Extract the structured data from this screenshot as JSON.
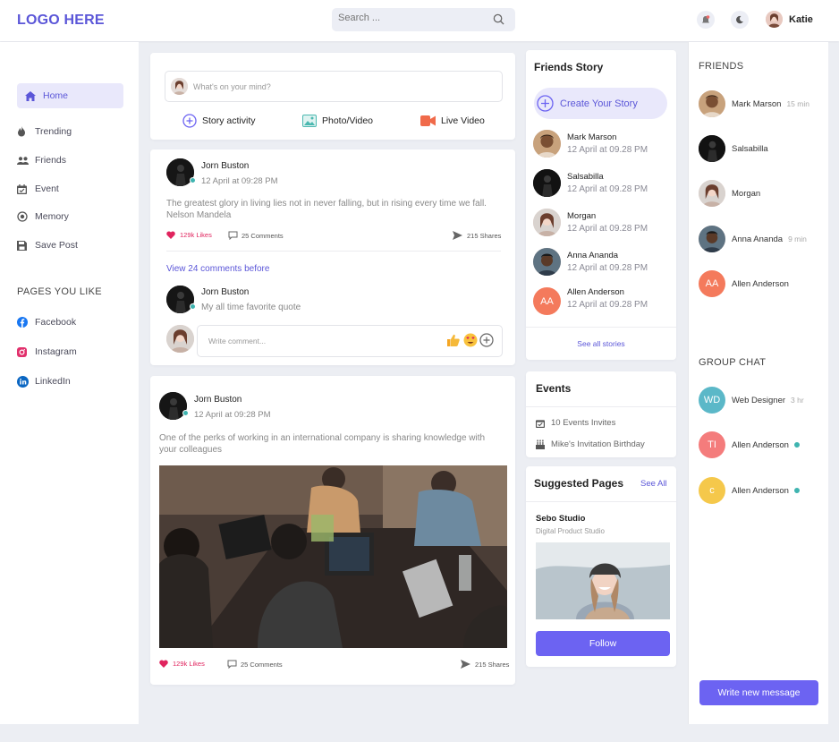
{
  "header": {
    "logo": "LOGO HERE",
    "search_placeholder": "Search ...",
    "user_name": "Katie"
  },
  "sidebar": {
    "items": [
      {
        "label": "Home",
        "icon": "home-icon"
      },
      {
        "label": "Trending",
        "icon": "flame-icon"
      },
      {
        "label": "Friends",
        "icon": "friends-icon"
      },
      {
        "label": "Event",
        "icon": "calendar-icon"
      },
      {
        "label": "Memory",
        "icon": "memory-icon"
      },
      {
        "label": "Save Post",
        "icon": "save-icon"
      }
    ],
    "pages_title": "PAGES YOU LIKE",
    "pages": [
      {
        "label": "Facebook",
        "color": "#1877f2"
      },
      {
        "label": "Instagram",
        "color": "#e1306c"
      },
      {
        "label": "LinkedIn",
        "color": "#0a66c2"
      }
    ]
  },
  "composer": {
    "placeholder": "What's on your mind?",
    "actions": [
      {
        "label": "Story activity"
      },
      {
        "label": "Photo/Video"
      },
      {
        "label": "Live Video"
      }
    ]
  },
  "post1": {
    "author": "Jorn Buston",
    "time": "12 April at 09:28 PM",
    "text": "The greatest glory in living lies not in never falling, but in rising every time we fall. Nelson Mandela",
    "likes": "129k Likes",
    "comments": "25 Comments",
    "shares": "215 Shares",
    "view_comments": "View 24  comments before",
    "comment": {
      "author": "Jorn Buston",
      "text": "My all time favorite quote"
    },
    "write_placeholder": "Write comment..."
  },
  "post2": {
    "author": "Jorn Buston",
    "time": "12 April at 09:28 PM",
    "text": "One of the perks of working in an international company is sharing knowledge with your colleagues",
    "likes": "129k Likes",
    "comments": "25 Comments",
    "shares": "215 Shares"
  },
  "stories": {
    "title": "Friends Story",
    "create": "Create Your Story",
    "items": [
      {
        "name": "Mark Marson",
        "time": "12 April at 09.28 PM"
      },
      {
        "name": "Salsabilla",
        "time": "12 April at 09.28 PM"
      },
      {
        "name": "Morgan",
        "time": "12 April at 09.28 PM"
      },
      {
        "name": "Anna Ananda",
        "time": "12 April at 09.28 PM"
      },
      {
        "name": "Allen Anderson",
        "time": "12 April at 09.28 PM",
        "initials": "AA"
      }
    ],
    "see_all": "See all stories"
  },
  "events": {
    "title": "Events",
    "items": [
      {
        "label": "10 Events Invites"
      },
      {
        "label": "Mike's Invitation Birthday"
      }
    ]
  },
  "suggested": {
    "title": "Suggested Pages",
    "see_all": "See All",
    "page_name": "Sebo Studio",
    "page_sub": "Digital Product Studio",
    "follow": "Follow"
  },
  "friends": {
    "title": "FRIENDS",
    "items": [
      {
        "name": "Mark Marson",
        "status": "15 min"
      },
      {
        "name": "Salsabilla",
        "status": ""
      },
      {
        "name": "Morgan",
        "status": ""
      },
      {
        "name": "Anna Ananda",
        "status": "9 min"
      },
      {
        "name": "Allen Anderson",
        "status": "",
        "initials": "AA"
      }
    ]
  },
  "group_chat": {
    "title": "GROUP CHAT",
    "items": [
      {
        "name": "Web Designer",
        "status": "3 hr",
        "initials": "WD",
        "color": "#5bb8c8"
      },
      {
        "name": "Allen Anderson",
        "status": "",
        "initials": "TI",
        "color": "#f47c7c"
      },
      {
        "name": "Allen Anderson",
        "status": "",
        "initials": "c",
        "color": "#f5c84b"
      }
    ],
    "write_button": "Write new message"
  },
  "colors": {
    "accent": "#6c63f2",
    "like": "#e0245e",
    "online": "#3fb4b0"
  }
}
